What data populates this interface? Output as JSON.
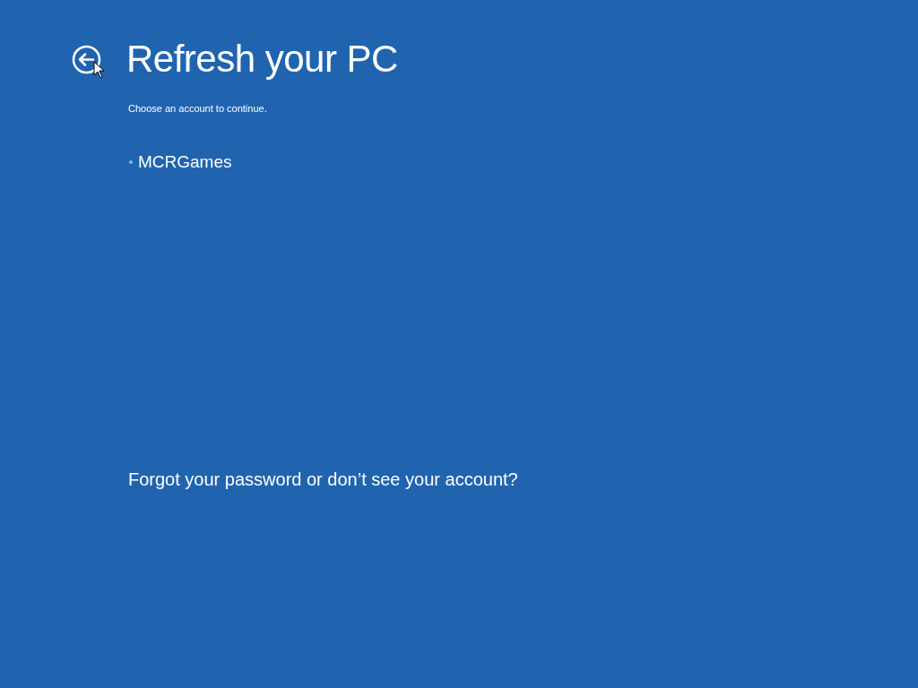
{
  "header": {
    "title": "Refresh your PC"
  },
  "instruction": "Choose an account to continue.",
  "accounts": [
    {
      "name": "MCRGames",
      "selected": false
    }
  ],
  "help_link": "Forgot your password or don’t see your account?"
}
